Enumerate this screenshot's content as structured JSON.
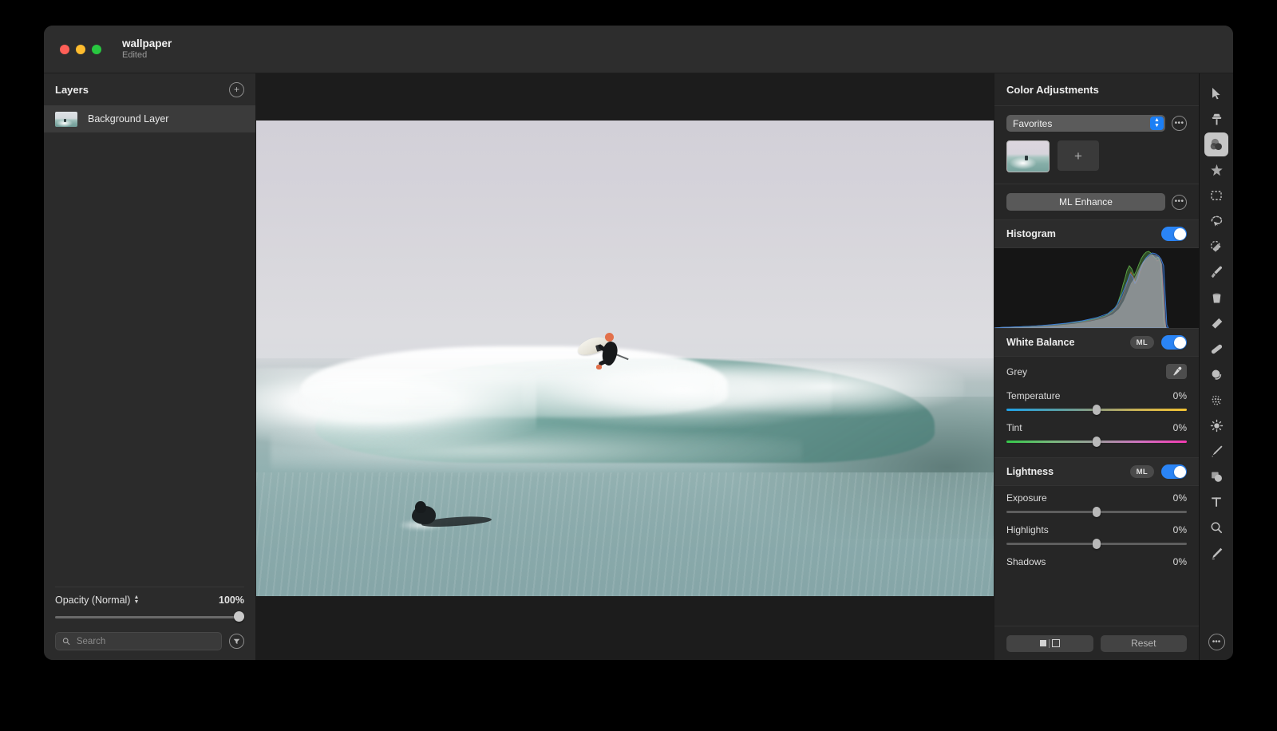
{
  "window": {
    "title": "wallpaper",
    "subtitle": "Edited",
    "traffic_lights": [
      "close",
      "minimize",
      "zoom"
    ]
  },
  "layers_panel": {
    "title": "Layers",
    "add_layer_icon": "plus-circle-icon",
    "layers": [
      {
        "name": "Background Layer",
        "selected": true
      }
    ],
    "opacity": {
      "label": "Opacity (Normal)",
      "value": "100%",
      "slider_position_percent": 100
    },
    "search": {
      "placeholder": "Search",
      "value": "",
      "icon": "search-icon",
      "filter_icon": "filter-icon"
    }
  },
  "adjust_panel": {
    "title": "Color Adjustments",
    "favorites": {
      "selected": "Favorites",
      "options": [
        "Favorites"
      ],
      "stepper_icon": "chevron-up-down-icon",
      "options_icon": "ellipsis-icon",
      "presets": [
        {
          "name": "surf-preset-thumbnail",
          "selected": true
        }
      ],
      "add_preset_label": "+"
    },
    "ml_enhance": {
      "label": "ML Enhance",
      "options_icon": "ellipsis-icon"
    },
    "histogram": {
      "title": "Histogram",
      "enabled": true
    },
    "white_balance": {
      "title": "White Balance",
      "ml_badge": "ML",
      "enabled": true,
      "grey": {
        "label": "Grey",
        "picker_icon": "eyedropper-icon"
      },
      "controls": [
        {
          "label": "Temperature",
          "value": "0%",
          "position_percent": 50,
          "gradient": "temp"
        },
        {
          "label": "Tint",
          "value": "0%",
          "position_percent": 50,
          "gradient": "tint"
        }
      ]
    },
    "lightness": {
      "title": "Lightness",
      "ml_badge": "ML",
      "enabled": true,
      "controls": [
        {
          "label": "Exposure",
          "value": "0%",
          "position_percent": 50
        },
        {
          "label": "Highlights",
          "value": "0%",
          "position_percent": 50
        },
        {
          "label": "Shadows",
          "value": "0%",
          "position_percent": 50
        }
      ]
    },
    "footer": {
      "compare_label": "",
      "reset_label": "Reset"
    }
  },
  "toolbar": {
    "tools": [
      {
        "name": "move-tool",
        "icon": "cursor-arrow-icon",
        "selected": false
      },
      {
        "name": "clone-stamp-tool",
        "icon": "clone-stamp-icon",
        "selected": false
      },
      {
        "name": "color-adjust-tool",
        "icon": "color-circles-icon",
        "selected": true
      },
      {
        "name": "retouch-tool",
        "icon": "sparkle-star-icon",
        "selected": false
      },
      {
        "name": "rect-select-tool",
        "icon": "marquee-icon",
        "selected": false
      },
      {
        "name": "lasso-select-tool",
        "icon": "lasso-icon",
        "selected": false
      },
      {
        "name": "magic-wand-tool",
        "icon": "magic-wand-icon",
        "selected": false
      },
      {
        "name": "brush-tool",
        "icon": "paintbrush-icon",
        "selected": false
      },
      {
        "name": "paint-bucket-tool",
        "icon": "paint-bucket-icon",
        "selected": false
      },
      {
        "name": "eraser-tool",
        "icon": "eraser-icon",
        "selected": false
      },
      {
        "name": "heal-tool",
        "icon": "bandage-icon",
        "selected": false
      },
      {
        "name": "dodge-burn-tool",
        "icon": "dodge-burn-icon",
        "selected": false
      },
      {
        "name": "noise-tool",
        "icon": "halftone-dots-icon",
        "selected": false
      },
      {
        "name": "brightness-tool",
        "icon": "sun-icon",
        "selected": false
      },
      {
        "name": "pen-tool",
        "icon": "fountain-pen-icon",
        "selected": false
      },
      {
        "name": "shapes-tool",
        "icon": "shapes-icon",
        "selected": false
      },
      {
        "name": "text-tool",
        "icon": "text-t-icon",
        "selected": false
      },
      {
        "name": "zoom-tool",
        "icon": "magnifier-icon",
        "selected": false
      },
      {
        "name": "gradient-tool",
        "icon": "gradient-pen-icon",
        "selected": false
      }
    ],
    "more_icon": "ellipsis-icon"
  },
  "colors": {
    "accent_blue": "#2a84f5",
    "panel_bg": "#262626",
    "layers_bg": "#2b2b2b",
    "selected_row": "#3b3b3b",
    "canvas_bg": "#1c1c1c",
    "histogram_bg": "#151515"
  }
}
